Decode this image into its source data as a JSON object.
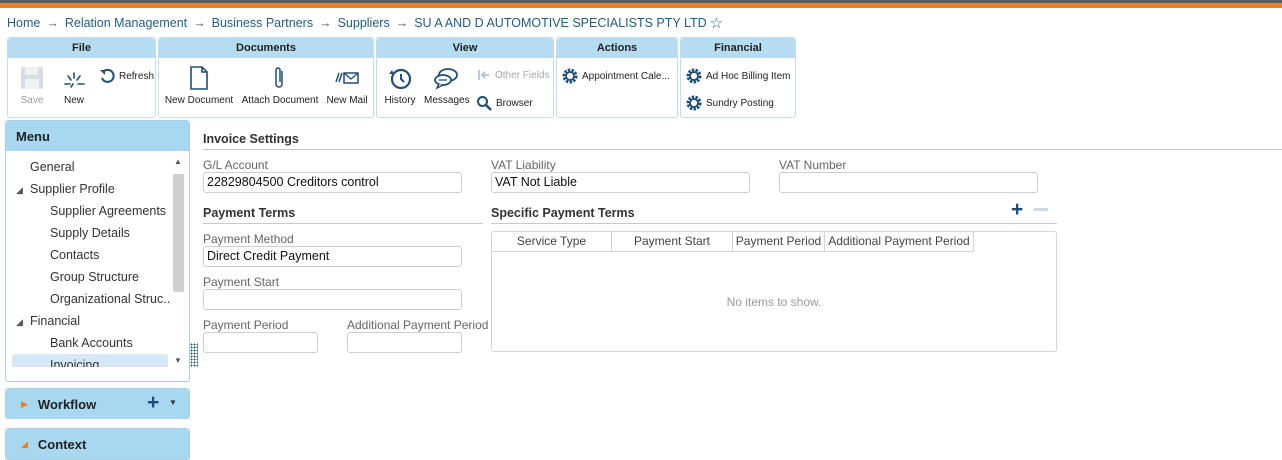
{
  "breadcrumb": {
    "items": [
      "Home",
      "Relation Management",
      "Business Partners",
      "Suppliers",
      "SU A AND D AUTOMOTIVE SPECIALISTS PTY LTD"
    ],
    "separator": "→"
  },
  "ribbon": {
    "file": {
      "title": "File",
      "save": "Save",
      "new": "New",
      "refresh": "Refresh"
    },
    "documents": {
      "title": "Documents",
      "new_document": "New Document",
      "attach_document": "Attach Document",
      "new_mail": "New Mail"
    },
    "view": {
      "title": "View",
      "history": "History",
      "messages": "Messages",
      "other_fields": "Other Fields",
      "browser": "Browser"
    },
    "actions": {
      "title": "Actions",
      "appointment": "Appointment Cale..."
    },
    "financial": {
      "title": "Financial",
      "ad_hoc": "Ad Hoc Billing Item",
      "sundry": "Sundry Posting"
    }
  },
  "menu": {
    "title": "Menu",
    "items": [
      {
        "label": "General"
      },
      {
        "label": "Supplier Profile"
      },
      {
        "label": "Supplier Agreements"
      },
      {
        "label": "Supply Details"
      },
      {
        "label": "Contacts"
      },
      {
        "label": "Group Structure"
      },
      {
        "label": "Organizational Struc..."
      },
      {
        "label": "Financial"
      },
      {
        "label": "Bank Accounts"
      },
      {
        "label": "Invoicing"
      }
    ],
    "expand_glyph": "◢"
  },
  "workflow": {
    "title": "Workflow"
  },
  "context": {
    "title": "Context"
  },
  "invoice_settings": {
    "title": "Invoice Settings",
    "gl_account": {
      "label": "G/L Account",
      "value": "22829804500 Creditors control"
    },
    "vat_liability": {
      "label": "VAT Liability",
      "value": "VAT Not Liable"
    },
    "vat_number": {
      "label": "VAT Number",
      "value": ""
    }
  },
  "payment_terms": {
    "title": "Payment Terms",
    "payment_method": {
      "label": "Payment Method",
      "value": "Direct Credit Payment"
    },
    "payment_start": {
      "label": "Payment Start",
      "value": ""
    },
    "payment_period": {
      "label": "Payment Period",
      "value": ""
    },
    "additional_payment_period": {
      "label": "Additional Payment Period",
      "value": ""
    }
  },
  "specific_payment_terms": {
    "title": "Specific Payment Terms",
    "columns": [
      "Service Type",
      "Payment Start",
      "Payment Period",
      "Additional Payment Period"
    ],
    "empty_text": "No items to show."
  },
  "colors": {
    "accent_orange": "#f07d1e",
    "panel_header": "#a8d8ef",
    "link_blue": "#1f5d8c"
  }
}
